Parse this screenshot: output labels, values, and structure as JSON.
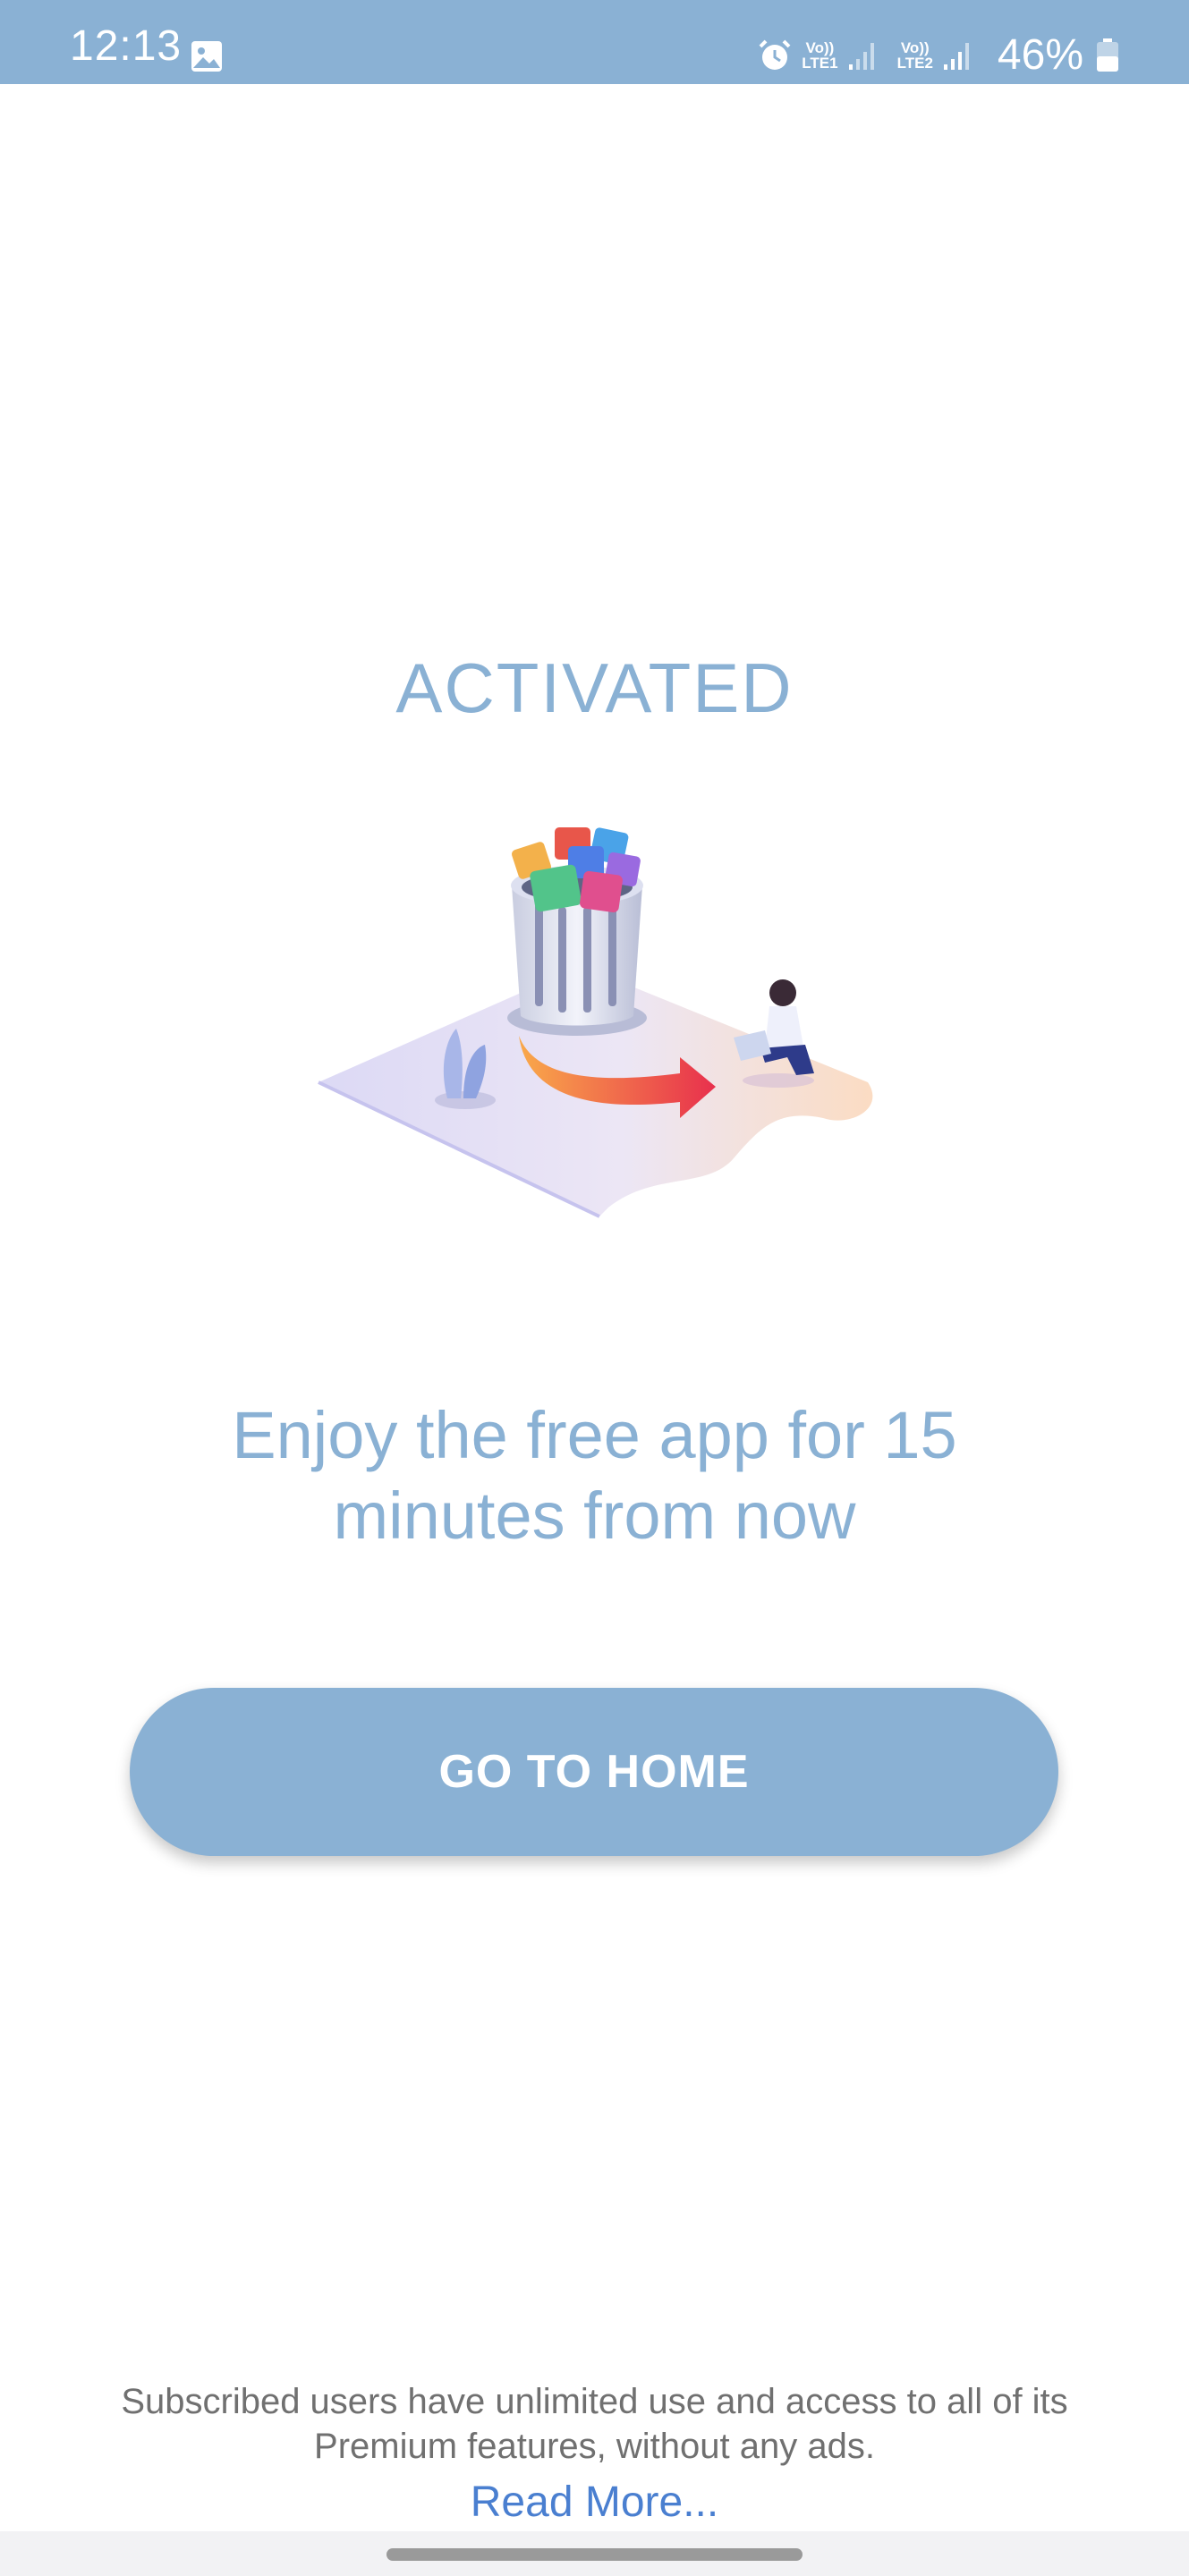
{
  "status_bar": {
    "time": "12:13",
    "sim1_line1": "Vo))",
    "sim1_line2": "LTE1",
    "sim2_line1": "Vo))",
    "sim2_line2": "LTE2",
    "battery_percent": "46%",
    "icons": [
      "gallery-icon",
      "alarm-icon",
      "signal-icon",
      "battery-icon"
    ]
  },
  "main": {
    "title": "ACTIVATED",
    "subtitle": "Enjoy the free app for 15 minutes from now",
    "button_label": "GO TO HOME",
    "illustration": "recycle-bin-illustration"
  },
  "footer": {
    "note": "Subscribed users have unlimited use and access to all of its Premium features, without any ads.",
    "read_more": "Read More..."
  },
  "colors": {
    "accent": "#8ab1d4",
    "link": "#4a7fd0",
    "note_text": "#707070",
    "background": "#ffffff"
  }
}
